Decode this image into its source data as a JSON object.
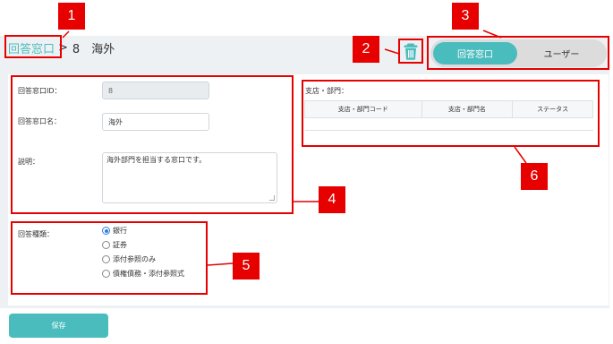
{
  "breadcrumb": {
    "link": "回答窓口",
    "separator": ">",
    "current": "8　海外"
  },
  "toggle": {
    "active_label": "回答窓口",
    "inactive_label": "ユーザー"
  },
  "form": {
    "id_label": "回答窓口ID：",
    "id_value": "8",
    "name_label": "回答窓口名：",
    "name_value": "海外",
    "desc_label": "説明：",
    "desc_value": "海外部門を担当する窓口です。",
    "type_label": "回答種類：",
    "type_options": [
      {
        "label": "銀行",
        "checked": true
      },
      {
        "label": "証券",
        "checked": false
      },
      {
        "label": "添付参照のみ",
        "checked": false
      },
      {
        "label": "債権債務・添付参照式",
        "checked": false
      }
    ]
  },
  "branch": {
    "label": "支店・部門：",
    "columns": [
      "支店・部門コード",
      "支店・部門名",
      "ステータス"
    ]
  },
  "save_label": "保存",
  "annotations": [
    "1",
    "2",
    "3",
    "4",
    "5",
    "6"
  ],
  "colors": {
    "accent": "#4bbcbd",
    "annotation": "#e60000",
    "panel_bg": "#eef1f4",
    "radio_selected": "#2f7ae5"
  },
  "icons": {
    "delete": "trash-icon"
  }
}
